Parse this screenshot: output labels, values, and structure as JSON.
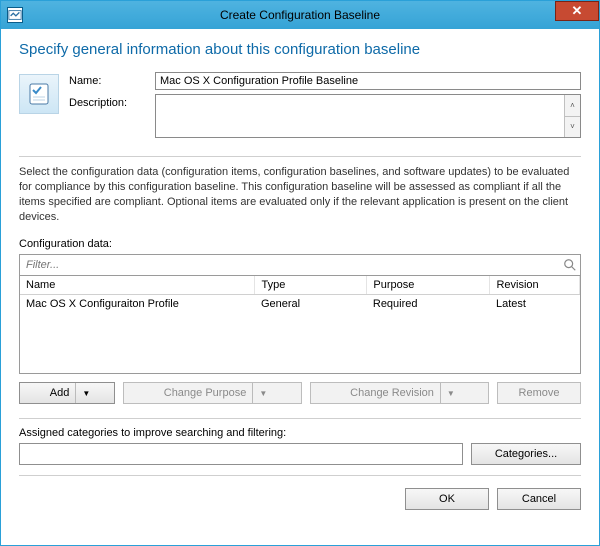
{
  "window": {
    "title": "Create Configuration Baseline"
  },
  "heading": "Specify general information about this configuration baseline",
  "fields": {
    "name_label": "Name:",
    "name_value": "Mac OS X Configuration Profile Baseline",
    "desc_label": "Description:",
    "desc_value": ""
  },
  "instructions": "Select the configuration data (configuration items, configuration baselines, and software updates) to be evaluated for compliance by this configuration baseline. This configuration baseline will be assessed as compliant if all the items specified are compliant. Optional items are evaluated only if the relevant application is present on  the client devices.",
  "config_data": {
    "label": "Configuration data:",
    "filter_placeholder": "Filter...",
    "columns": {
      "name": "Name",
      "type": "Type",
      "purpose": "Purpose",
      "revision": "Revision"
    },
    "rows": [
      {
        "name": "Mac OS X Configuraiton Profile",
        "type": "General",
        "purpose": "Required",
        "revision": "Latest"
      }
    ]
  },
  "buttons": {
    "add": "Add",
    "change_purpose": "Change Purpose",
    "change_revision": "Change Revision",
    "remove": "Remove",
    "categories": "Categories...",
    "ok": "OK",
    "cancel": "Cancel"
  },
  "assigned_label": "Assigned categories to improve searching and filtering:"
}
